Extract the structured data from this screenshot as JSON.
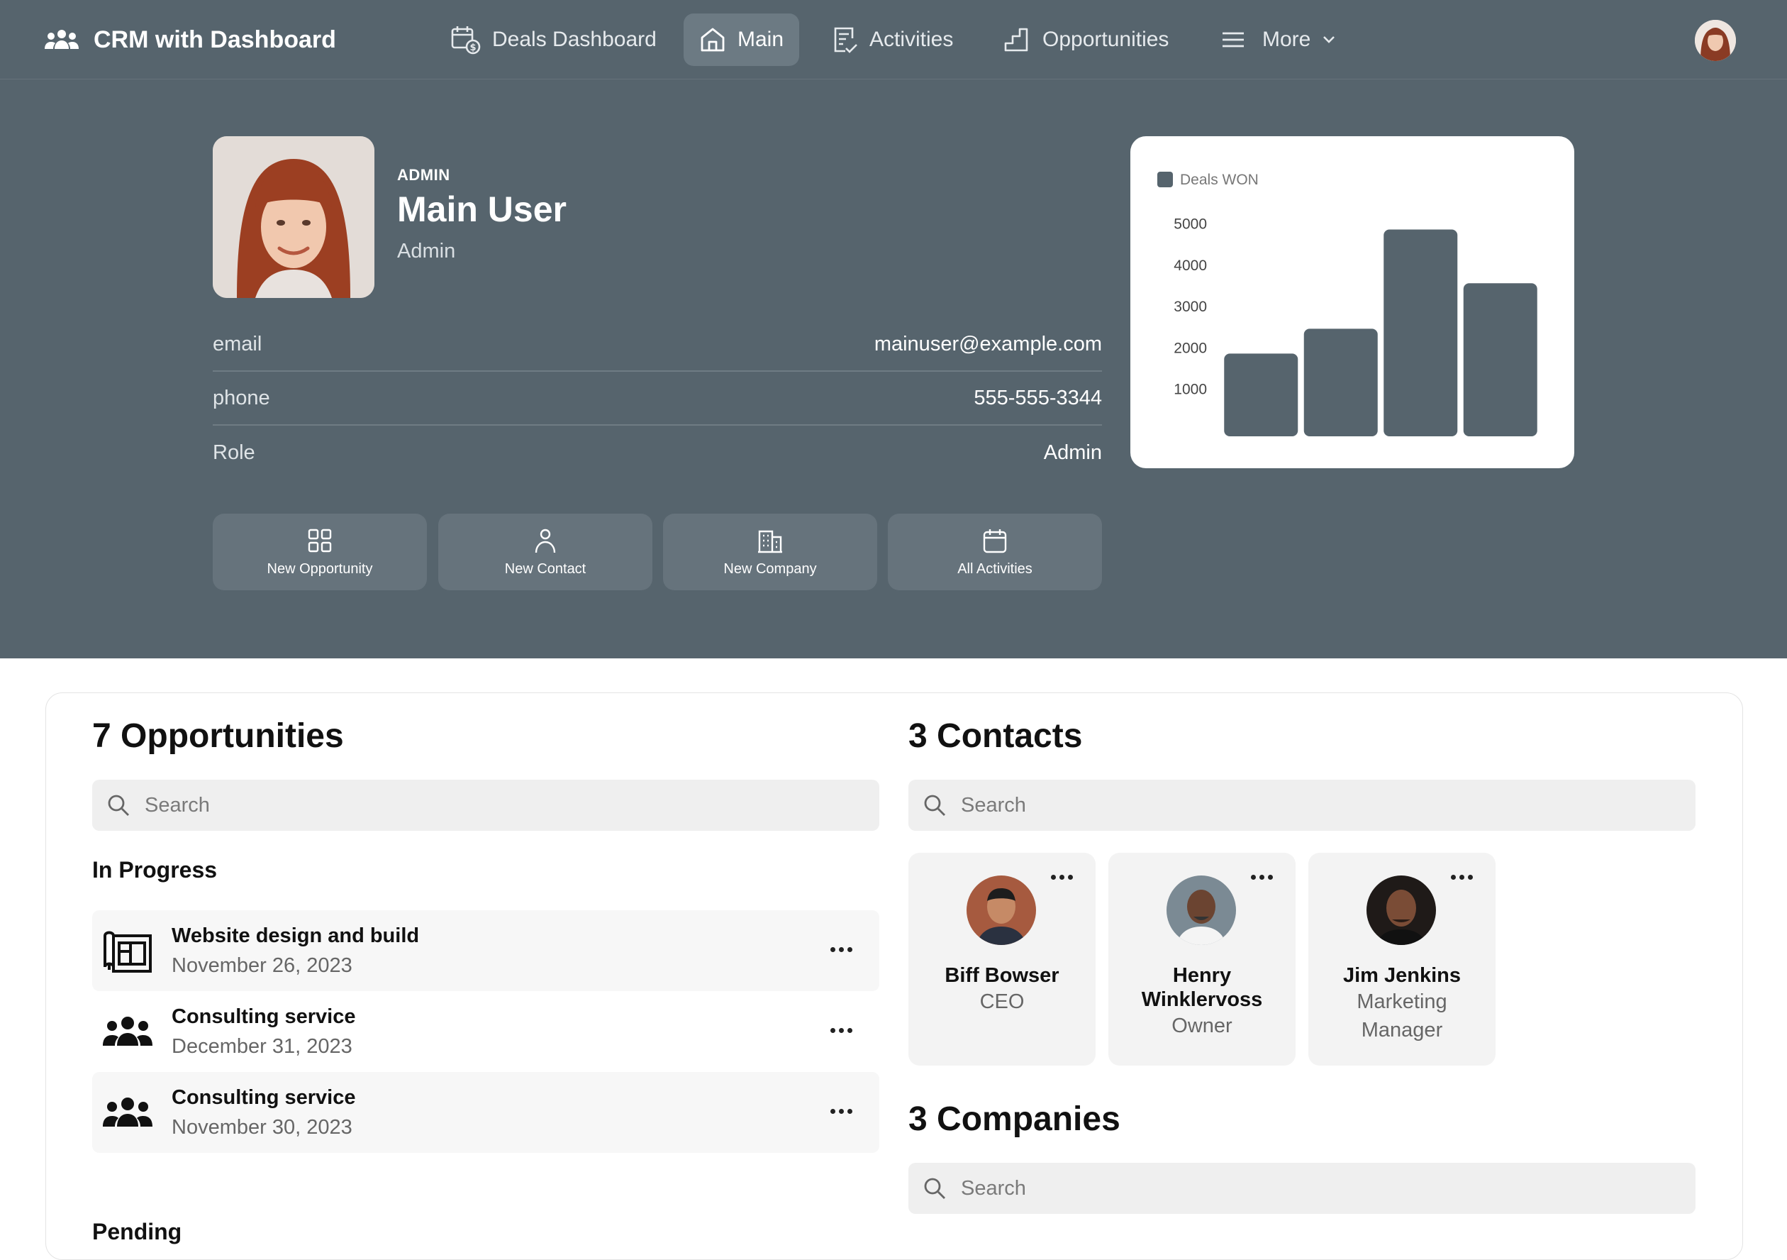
{
  "app": {
    "title": "CRM with Dashboard"
  },
  "nav": {
    "items": [
      {
        "label": "Deals Dashboard",
        "icon": "calendar-dollar-icon"
      },
      {
        "label": "Main",
        "icon": "home-icon",
        "active": true
      },
      {
        "label": "Activities",
        "icon": "checklist-icon"
      },
      {
        "label": "Opportunities",
        "icon": "stairs-icon"
      },
      {
        "label": "More",
        "icon": "menu-icon"
      }
    ]
  },
  "profile": {
    "role_caption": "ADMIN",
    "name": "Main User",
    "subtitle": "Admin",
    "fields": [
      {
        "label": "email",
        "value": "mainuser@example.com"
      },
      {
        "label": "phone",
        "value": "555-555-3344"
      },
      {
        "label": "Role",
        "value": "Admin"
      }
    ]
  },
  "quick_actions": [
    {
      "label": "New Opportunity",
      "icon": "grid-icon"
    },
    {
      "label": "New Contact",
      "icon": "person-icon"
    },
    {
      "label": "New Company",
      "icon": "building-icon"
    },
    {
      "label": "All Activities",
      "icon": "calendar-icon"
    }
  ],
  "chart_data": {
    "type": "bar",
    "legend": [
      "Deals WON"
    ],
    "legend_position": "top-left",
    "series": [
      {
        "name": "Deals WON",
        "values": [
          2000,
          2600,
          5000,
          3700
        ]
      }
    ],
    "yticks": [
      1000,
      2000,
      3000,
      4000,
      5000
    ],
    "ylim": [
      0,
      5000
    ],
    "grid": false,
    "color": "#56646d"
  },
  "opportunities": {
    "title": "7 Opportunities",
    "search_placeholder": "Search",
    "groups": [
      {
        "label": "In Progress",
        "items": [
          {
            "title": "Website design and build",
            "date": "November 26, 2023",
            "icon": "blueprint-icon"
          },
          {
            "title": "Consulting service",
            "date": "December 31, 2023",
            "icon": "people-group-icon"
          },
          {
            "title": "Consulting service",
            "date": "November 30, 2023",
            "icon": "people-group-icon"
          }
        ]
      },
      {
        "label": "Pending",
        "items": []
      }
    ]
  },
  "contacts": {
    "title": "3 Contacts",
    "search_placeholder": "Search",
    "items": [
      {
        "name": "Biff Bowser",
        "role": "CEO"
      },
      {
        "name": "Henry Winklervoss",
        "role": "Owner"
      },
      {
        "name": "Jim Jenkins",
        "role": "Marketing Manager"
      }
    ]
  },
  "companies": {
    "title": "3 Companies",
    "search_placeholder": "Search"
  }
}
